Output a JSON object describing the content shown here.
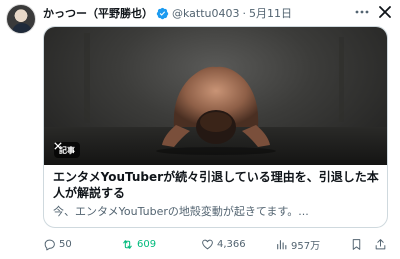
{
  "author": {
    "display_name": "かっつー（平野勝也）",
    "handle": "@kattu0403",
    "separator": "·",
    "date": "5月11日"
  },
  "card": {
    "source_label": "記事",
    "title": "エンタメYouTuberが続々引退している理由を、引退した本人が解説する",
    "description": "今、エンタメYouTuberの地殻変動が起きてます。..."
  },
  "metrics": {
    "replies": "50",
    "reposts": "609",
    "likes": "4,366",
    "views": "957万"
  },
  "colors": {
    "verified": "#1d9bf0",
    "repost_active": "#00ba7c",
    "secondary_text": "#536471",
    "border": "#cfd9de"
  },
  "icons": [
    "verified-badge-icon",
    "more-icon",
    "close-icon",
    "x-logo-icon",
    "reply-icon",
    "repost-icon",
    "like-icon",
    "views-icon",
    "bookmark-icon",
    "share-icon"
  ]
}
